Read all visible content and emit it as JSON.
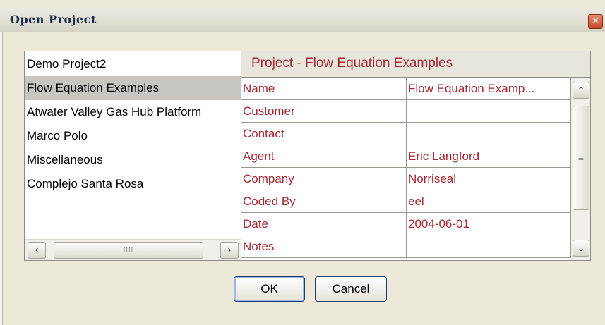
{
  "window": {
    "title": "Open Project",
    "close_label": "✕"
  },
  "project_list": {
    "items": [
      {
        "label": "Demo Project2",
        "selected": false
      },
      {
        "label": "Flow Equation Examples",
        "selected": true
      },
      {
        "label": "Atwater Valley Gas Hub Platform",
        "selected": false
      },
      {
        "label": "Marco Polo",
        "selected": false
      },
      {
        "label": "Miscellaneous",
        "selected": false
      },
      {
        "label": "Complejo Santa Rosa",
        "selected": false
      }
    ],
    "scroll_left_icon": "‹",
    "scroll_right_icon": "›",
    "scroll_thumb_grip": "IIII"
  },
  "details": {
    "header": "Project - Flow Equation Examples",
    "rows": [
      {
        "key": "Name",
        "value": "Flow Equation Examp..."
      },
      {
        "key": "Customer",
        "value": ""
      },
      {
        "key": "Contact",
        "value": ""
      },
      {
        "key": "Agent",
        "value": "Eric Langford"
      },
      {
        "key": "Company",
        "value": "Norriseal"
      },
      {
        "key": "Coded By",
        "value": "eel"
      },
      {
        "key": "Date",
        "value": "2004-06-01"
      },
      {
        "key": "Notes",
        "value": ""
      }
    ],
    "scroll_up_icon": "⌃",
    "scroll_down_icon": "⌄",
    "scroll_thumb_grip": "≡"
  },
  "buttons": {
    "ok_label": "OK",
    "cancel_label": "Cancel"
  },
  "colors": {
    "accent_text": "#a42832",
    "selection": "#c8c6c0",
    "button_border": "#1c3b73"
  }
}
